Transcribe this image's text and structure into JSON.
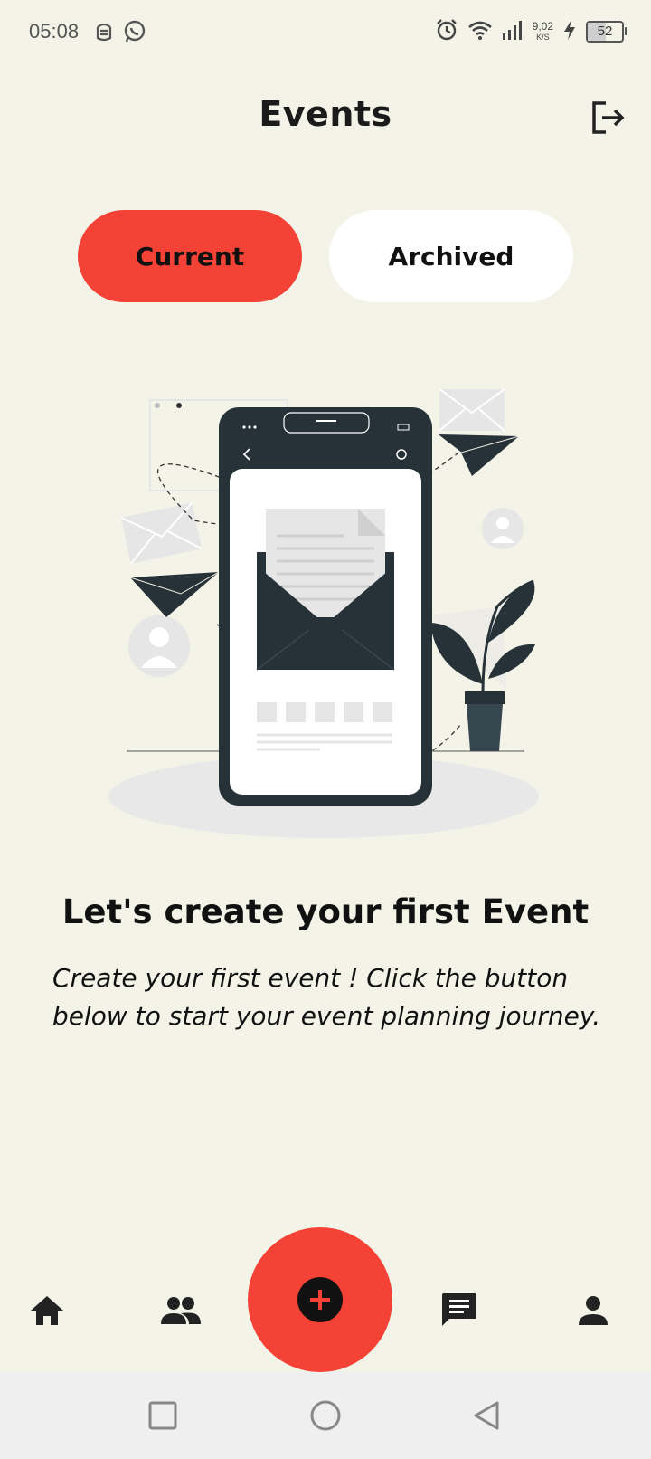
{
  "status_bar": {
    "time": "05:08",
    "net_speed_value": "9,02",
    "net_speed_unit": "K/S",
    "battery_level": "52",
    "icons": [
      "gesture-app-icon",
      "whatsapp-icon",
      "alarm-icon",
      "wifi-icon",
      "signal-icon",
      "charging-icon",
      "battery-icon"
    ]
  },
  "header": {
    "title": "Events",
    "logout_icon": "logout-icon"
  },
  "tabs": [
    {
      "label": "Current",
      "active": true
    },
    {
      "label": "Archived",
      "active": false
    }
  ],
  "empty_state": {
    "illustration": "phone-with-envelope-illustration",
    "title": "Let's create your first Event",
    "description": "Create your first event ! Click the button below to start your event planning journey."
  },
  "bottom_nav": {
    "items": [
      "home-icon",
      "people-icon",
      "add-icon",
      "chat-icon",
      "profile-icon"
    ]
  },
  "system_nav": [
    "recents-icon",
    "home-circle-icon",
    "back-icon"
  ],
  "colors": {
    "background": "#f4f3e8",
    "accent": "#f44336",
    "dark": "#111111",
    "system_nav_bg": "#efefef"
  }
}
